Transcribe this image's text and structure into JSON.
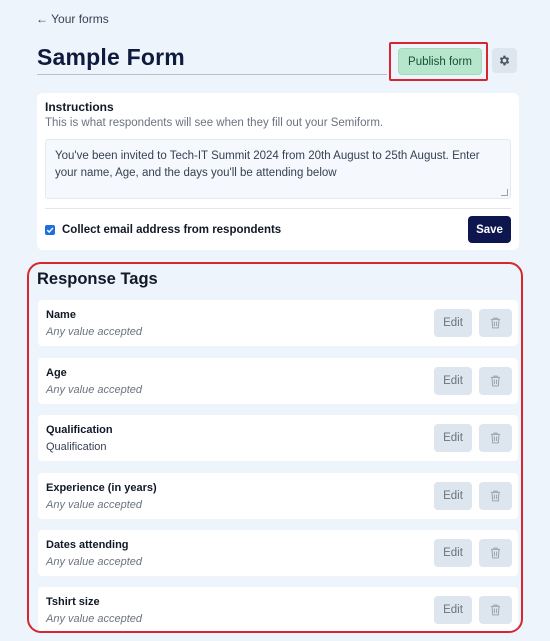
{
  "nav": {
    "back_label": "← Your forms"
  },
  "header": {
    "title": "Sample Form",
    "publish_label": "Publish form",
    "settings_icon": "gear-icon"
  },
  "instructions": {
    "heading": "Instructions",
    "subheading": "This is what respondents will see when they fill out your Semiform.",
    "text": "You've been invited to Tech-IT Summit 2024 from 20th August to 25th August. Enter your name, Age, and the days you'll be attending below",
    "collect_email_label": "Collect email address from respondents",
    "collect_email_checked": true,
    "save_label": "Save"
  },
  "response_tags": {
    "title": "Response Tags",
    "edit_label": "Edit",
    "delete_icon": "trash-icon",
    "items": [
      {
        "name": "Name",
        "value": "Any value accepted"
      },
      {
        "name": "Age",
        "value": "Any value accepted"
      },
      {
        "name": "Qualification",
        "value": "Qualification"
      },
      {
        "name": "Experience (in years)",
        "value": "Any value accepted"
      },
      {
        "name": "Dates attending",
        "value": "Any value accepted"
      },
      {
        "name": "Tshirt size",
        "value": "Any value accepted"
      }
    ]
  },
  "colors": {
    "background": "#eef4fb",
    "publish_button": "#b7e6cc",
    "save_button": "#0e1650",
    "highlight": "#d7262f",
    "checkbox": "#1d6fe0"
  }
}
